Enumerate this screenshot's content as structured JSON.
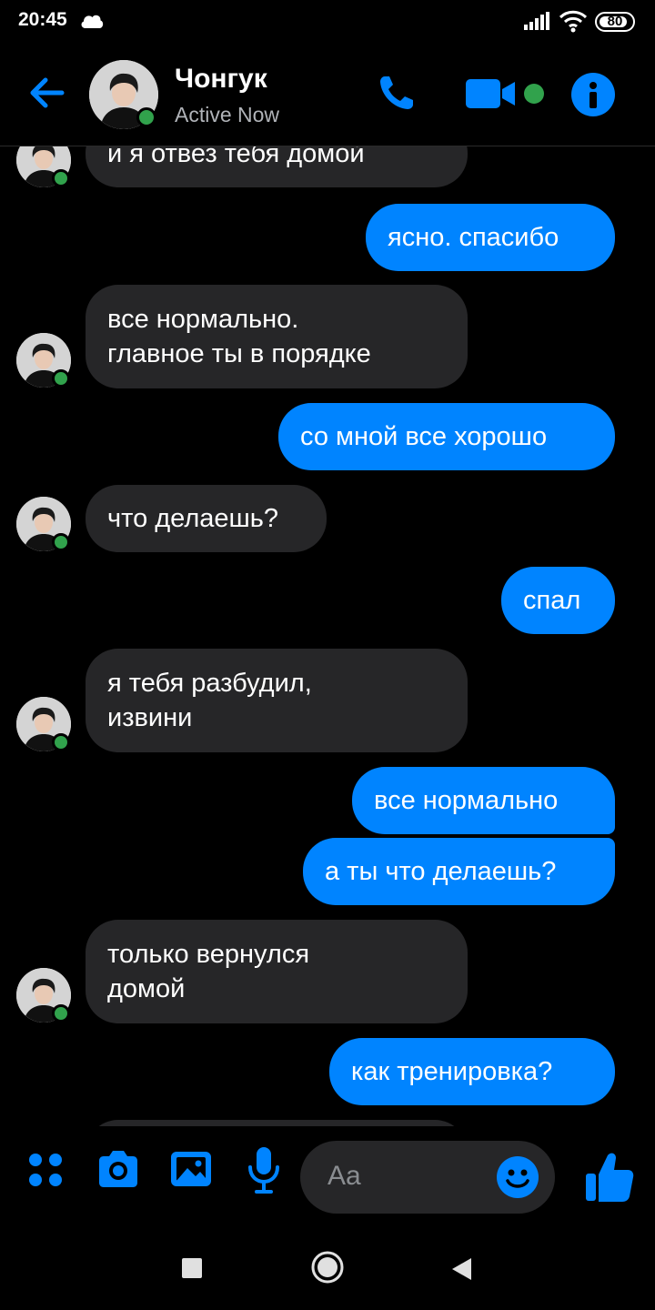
{
  "status_bar": {
    "time": "20:45",
    "battery": "80"
  },
  "header": {
    "back_icon": "arrow-left-icon",
    "contact_name": "Чонгук",
    "contact_status": "Active Now"
  },
  "messages": [
    {
      "sender": "contact",
      "lines": [
        "и я отвез тебя домой"
      ]
    },
    {
      "sender": "me",
      "lines": [
        "ясно. спасибо"
      ]
    },
    {
      "sender": "contact",
      "lines": [
        "все нормально.",
        "главное ты в порядке"
      ]
    },
    {
      "sender": "me",
      "lines": [
        "со мной все хорошо"
      ]
    },
    {
      "sender": "contact",
      "lines": [
        "что делаешь?"
      ]
    },
    {
      "sender": "me",
      "lines": [
        "спал"
      ]
    },
    {
      "sender": "contact",
      "lines": [
        "я тебя разбудил,",
        "извини"
      ]
    },
    {
      "sender": "me",
      "lines": [
        "все нормально"
      ]
    },
    {
      "sender": "me",
      "lines": [
        "а ты что делаешь?"
      ]
    },
    {
      "sender": "contact",
      "lines": [
        "только вернулся",
        "домой"
      ]
    },
    {
      "sender": "me",
      "lines": [
        "как тренировка?"
      ]
    }
  ],
  "composer": {
    "placeholder": "Aa"
  },
  "colors": {
    "accent": "#0084ff",
    "incoming_bubble": "#262628",
    "online": "#31a24c",
    "background": "#000000"
  }
}
